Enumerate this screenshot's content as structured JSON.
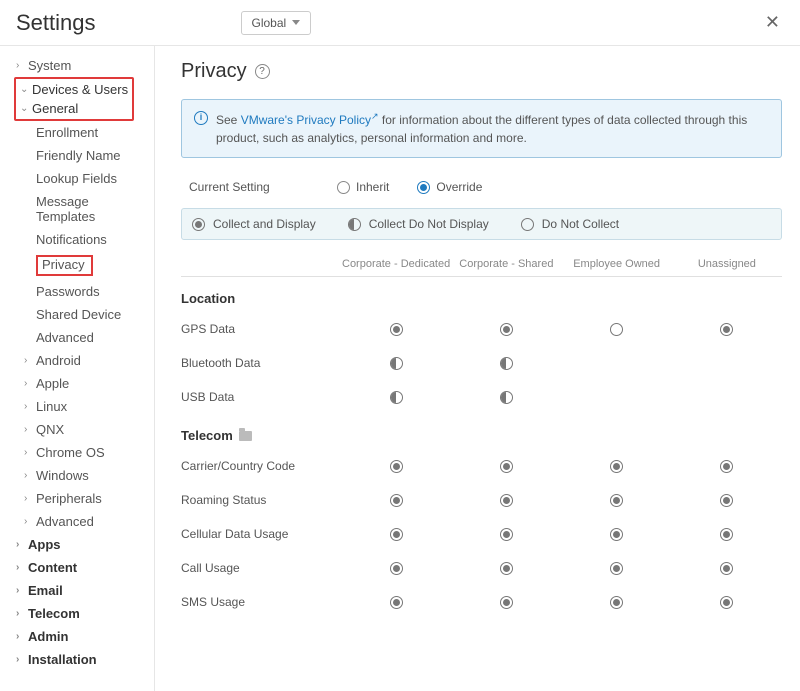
{
  "header": {
    "title": "Settings",
    "scope": "Global"
  },
  "sidebar": {
    "system": "System",
    "devices_users": "Devices & Users",
    "general": "General",
    "general_items": [
      "Enrollment",
      "Friendly Name",
      "Lookup Fields",
      "Message Templates",
      "Notifications",
      "Privacy",
      "Passwords",
      "Shared Device",
      "Advanced"
    ],
    "platforms": [
      "Android",
      "Apple",
      "Linux",
      "QNX",
      "Chrome OS",
      "Windows",
      "Peripherals",
      "Advanced"
    ],
    "tail": [
      "Apps",
      "Content",
      "Email",
      "Telecom",
      "Admin",
      "Installation"
    ]
  },
  "page": {
    "title": "Privacy",
    "info_prefix": "See ",
    "info_link": "VMware's Privacy Policy",
    "info_suffix": " for information about the different types of data collected through this product, such as analytics, personal information and more.",
    "current_setting_label": "Current Setting",
    "inherit": "Inherit",
    "override": "Override",
    "legend": {
      "collect_display": "Collect and Display",
      "collect_no_display": "Collect Do Not Display",
      "no_collect": "Do Not Collect"
    },
    "columns": [
      "Corporate - Dedicated",
      "Corporate - Shared",
      "Employee Owned",
      "Unassigned"
    ],
    "sections": {
      "location": {
        "title": "Location",
        "rows": [
          "GPS Data",
          "Bluetooth Data",
          "USB Data"
        ]
      },
      "telecom": {
        "title": "Telecom",
        "rows": [
          "Carrier/Country Code",
          "Roaming Status",
          "Cellular Data Usage",
          "Call Usage",
          "SMS Usage"
        ]
      }
    },
    "matrix": {
      "location": [
        [
          "full",
          "full",
          "empty",
          "full"
        ],
        [
          "half",
          "half",
          "",
          ""
        ],
        [
          "half",
          "half",
          "",
          ""
        ]
      ],
      "telecom": [
        [
          "full",
          "full",
          "full",
          "full"
        ],
        [
          "full",
          "full",
          "full",
          "full"
        ],
        [
          "full",
          "full",
          "full",
          "full"
        ],
        [
          "full",
          "full",
          "full",
          "full"
        ],
        [
          "full",
          "full",
          "full",
          "full"
        ]
      ]
    }
  }
}
